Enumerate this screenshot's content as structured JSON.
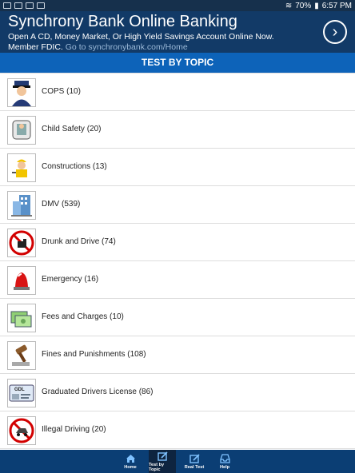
{
  "status": {
    "battery": "70%",
    "time": "6:57 PM"
  },
  "ad": {
    "title": "Synchrony Bank Online Banking",
    "line1": "Open A CD, Money Market, Or High Yield Savings Account Online Now.",
    "line2_prefix": "Member FDIC.",
    "line2_url": "Go to synchronybank.com/Home",
    "arrow_icon": "chevron-right-icon"
  },
  "header": {
    "title": "TEST BY TOPIC"
  },
  "topics": [
    {
      "label": "COPS (10)",
      "icon": "police-officer-icon"
    },
    {
      "label": "Child Safety (20)",
      "icon": "child-seat-icon"
    },
    {
      "label": "Constructions (13)",
      "icon": "construction-worker-icon"
    },
    {
      "label": "DMV (539)",
      "icon": "dmv-building-icon"
    },
    {
      "label": "Drunk and Drive (74)",
      "icon": "no-drinking-driving-icon"
    },
    {
      "label": "Emergency (16)",
      "icon": "emergency-siren-icon"
    },
    {
      "label": "Fees and Charges (10)",
      "icon": "cash-icon"
    },
    {
      "label": "Fines and Punishments (108)",
      "icon": "gavel-icon"
    },
    {
      "label": "Graduated Drivers License (86)",
      "icon": "license-card-icon"
    },
    {
      "label": "Illegal Driving (20)",
      "icon": "prohibited-driving-icon"
    }
  ],
  "tabs": [
    {
      "label": "Home",
      "icon": "home-icon"
    },
    {
      "label": "Test by Topic",
      "icon": "topic-edit-icon",
      "active": true
    },
    {
      "label": "Real Test",
      "icon": "test-edit-icon"
    },
    {
      "label": "Help",
      "icon": "inbox-icon"
    }
  ],
  "colors": {
    "header": "#0d63b9",
    "ad_background": "#123a67",
    "tabbar": "#0b3e74"
  }
}
